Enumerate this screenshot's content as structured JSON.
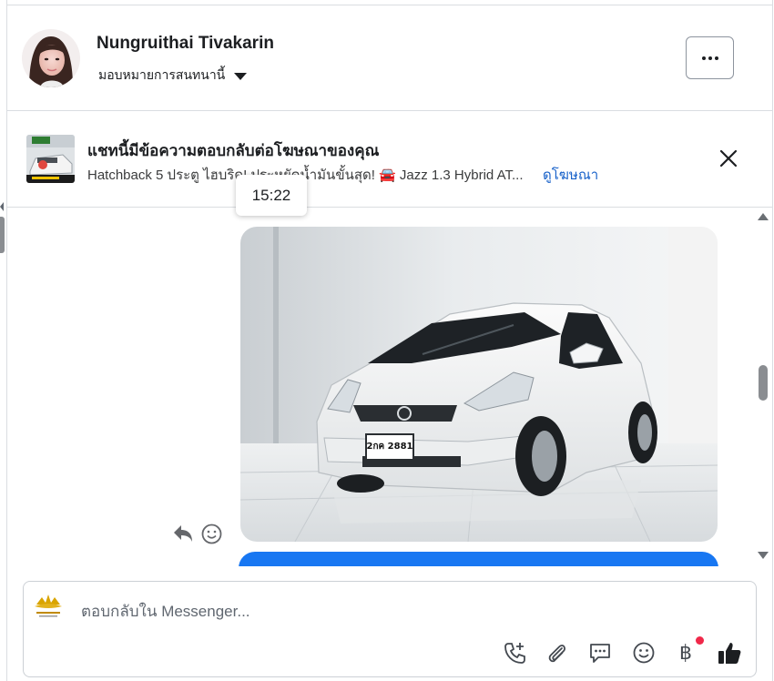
{
  "header": {
    "contact_name": "Nungruithai Tivakarin",
    "assign_label": "มอบหมายการสนทนานี้",
    "avatar_icon": "user-avatar",
    "more_icon": "ellipsis-icon"
  },
  "ad_banner": {
    "title": "แชทนี้มีข้อความตอบกลับต่อโฆษณาของคุณ",
    "description": "Hatchback 5 ประตู ไฮบริด! ประหยัดน้ำมันขั้นสุด! 🚘 Jazz 1.3 Hybrid AT...",
    "link_label": "ดูโฆษณา",
    "close_icon": "close-icon"
  },
  "conversation": {
    "timestamp": "15:22",
    "photo_plate": "2กค 2881",
    "actions": {
      "reply_icon": "reply-icon",
      "react_icon": "smiley-icon"
    }
  },
  "composer": {
    "placeholder": "ตอบกลับใน Messenger...",
    "tools": [
      "call-plus-icon",
      "attachment-icon",
      "saved-reply-icon",
      "emoji-icon",
      "baht-payment-icon",
      "thumbs-up-icon"
    ],
    "baht_symbol": "฿"
  },
  "colors": {
    "accent": "#1877f2",
    "link": "#1660c9",
    "notification": "#f02849"
  }
}
